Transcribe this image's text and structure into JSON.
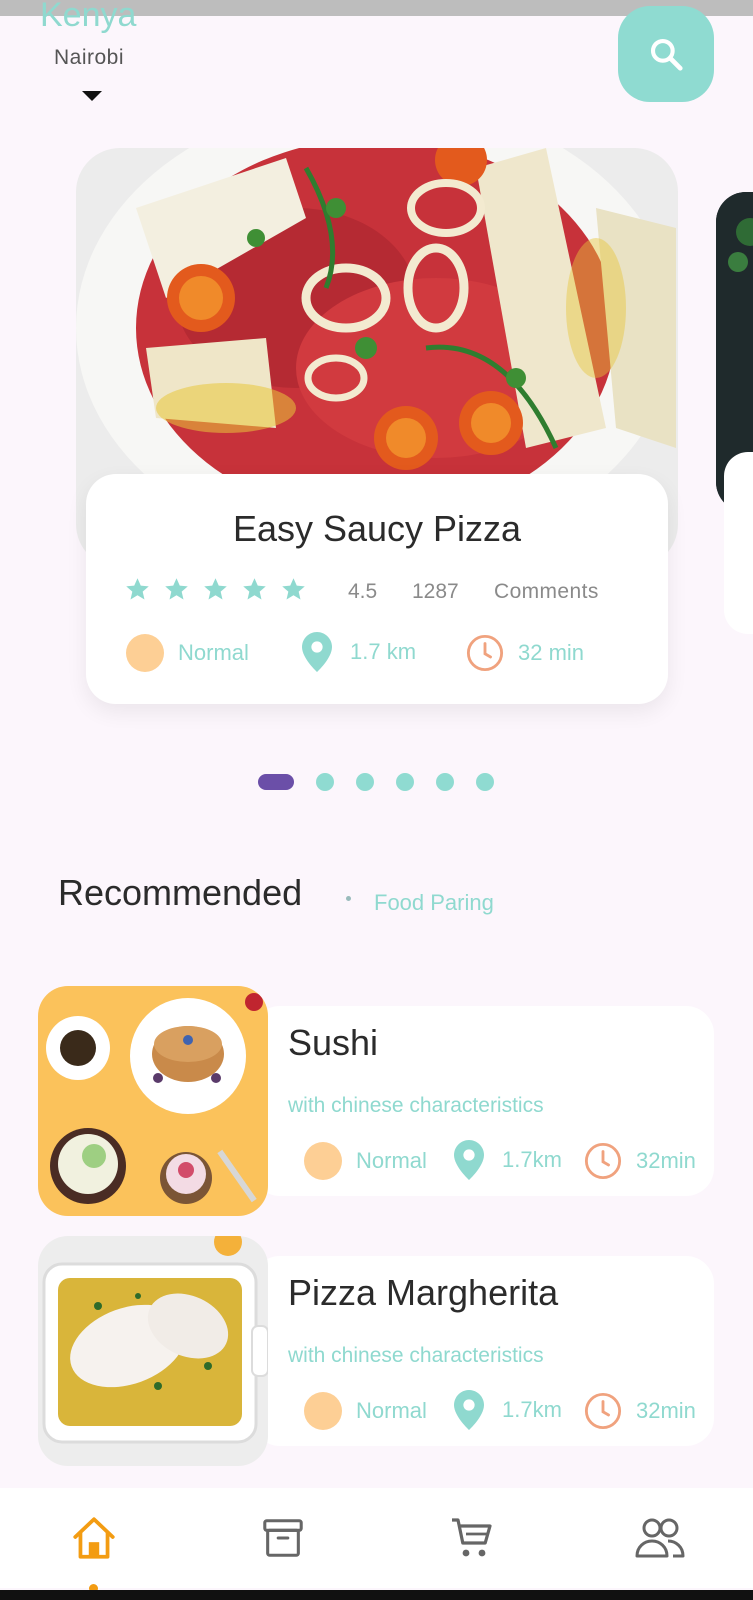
{
  "header": {
    "location_title": "Kenya",
    "location_sub": "Nairobi"
  },
  "icons": {
    "search": "search-icon",
    "caret": "caret-down-icon",
    "pin": "location-pin-icon",
    "clock": "clock-icon",
    "star": "star-icon"
  },
  "featured": {
    "title": "Easy Saucy Pizza",
    "stars": 5,
    "rating": "4.5",
    "comment_count": "1287",
    "comment_label": "Comments",
    "difficulty": "Normal",
    "distance": "1.7 km",
    "time": "32 min"
  },
  "carousel": {
    "pages": 6,
    "active_index": 0
  },
  "recommended": {
    "title": "Recommended",
    "link": "Food Paring",
    "items": [
      {
        "name": "Sushi",
        "subtitle": "with chinese characteristics",
        "difficulty": "Normal",
        "distance": "1.7km",
        "time": "32min"
      },
      {
        "name": "Pizza Margherita",
        "subtitle": "with chinese characteristics",
        "difficulty": "Normal",
        "distance": "1.7km",
        "time": "32min"
      }
    ]
  },
  "nav": {
    "items": [
      "home-icon",
      "archive-icon",
      "cart-icon",
      "users-icon"
    ],
    "active_index": 0
  },
  "colors": {
    "accent": "#8fd9cf",
    "orange_dot": "#fdcf95",
    "clock": "#f0a27e",
    "active_page": "#6b4fa8",
    "nav_active": "#f39c12"
  }
}
